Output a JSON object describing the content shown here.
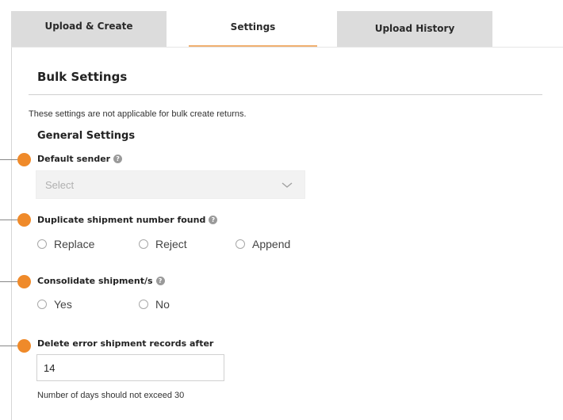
{
  "tabs": [
    {
      "label": "Upload & Create",
      "active": false
    },
    {
      "label": "Settings",
      "active": true
    },
    {
      "label": "Upload History",
      "active": false
    }
  ],
  "bulk_settings": {
    "title": "Bulk Settings",
    "note": "These settings are not applicable for bulk create returns.",
    "general_heading": "General Settings"
  },
  "default_sender": {
    "label": "Default sender",
    "select_value": "Select",
    "icon": "chevron-down-icon"
  },
  "duplicate": {
    "label": "Duplicate shipment number found",
    "options": [
      "Replace",
      "Reject",
      "Append"
    ]
  },
  "consolidate": {
    "label": "Consolidate shipment/s",
    "options": [
      "Yes",
      "No"
    ]
  },
  "delete_records": {
    "label": "Delete error shipment records after",
    "value": "14",
    "hint": "Number of days should not exceed 30"
  },
  "help_icon_glyph": "?",
  "colors": {
    "marker": "#ef8a2a",
    "tab_inactive": "#dcdcdc",
    "tab_underline": "#f0b070"
  }
}
